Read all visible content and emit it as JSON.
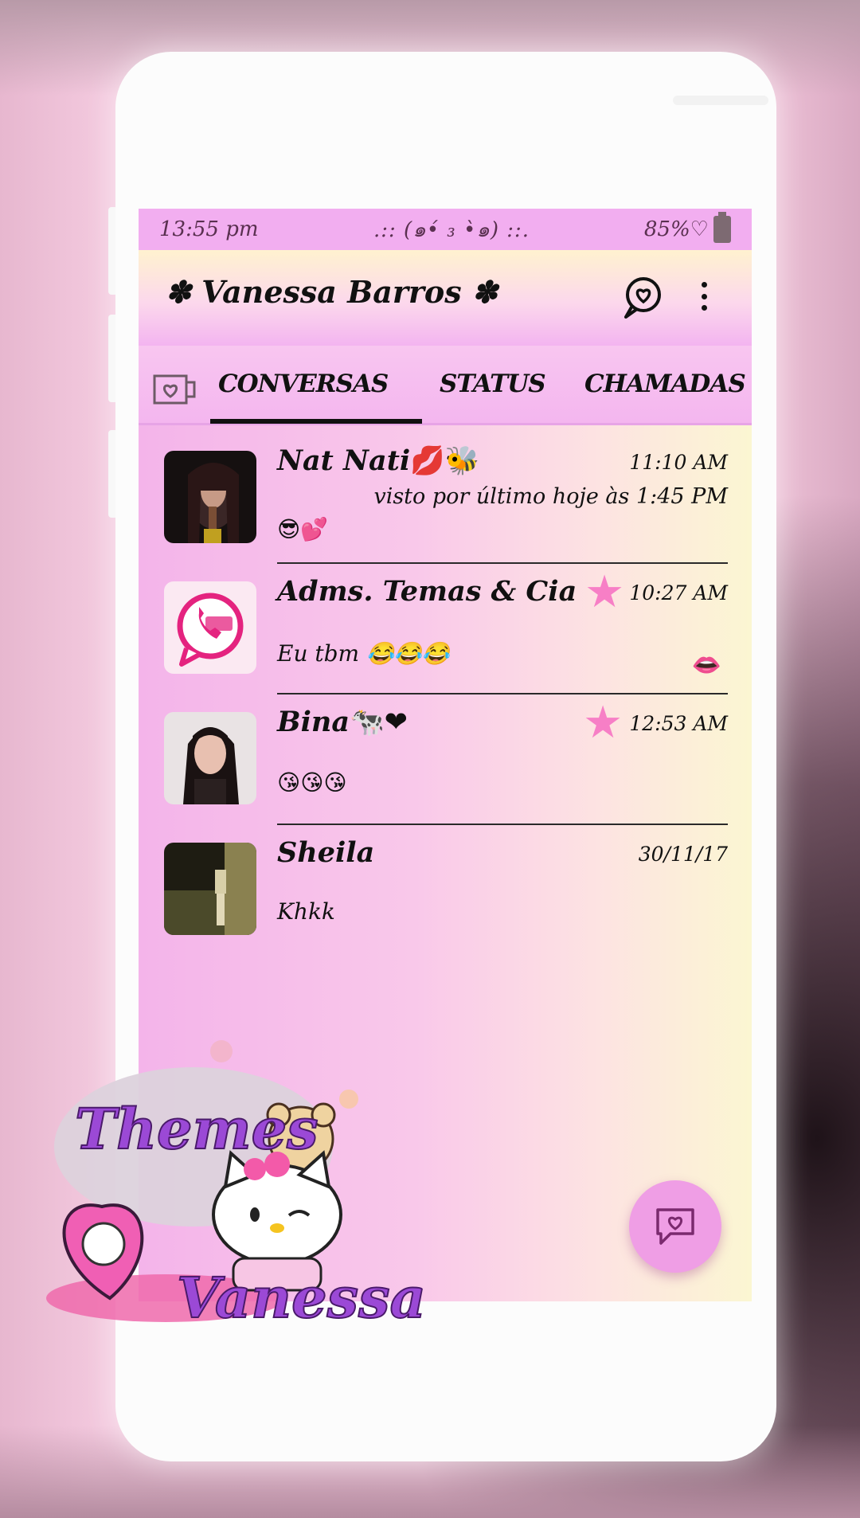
{
  "status_bar": {
    "time": "13:55 pm",
    "center_decoration": ".:: (๑•́ ₃ •̀๑) ::.",
    "battery": "85%♡"
  },
  "app_bar": {
    "title": "✽ Vanessa Barros ✽",
    "search_icon": "chat-heart-icon",
    "menu_icon": "more-vert-icon"
  },
  "tabs": {
    "camera_icon": "camera-heart-icon",
    "items": [
      {
        "label": "CONVERSAS",
        "selected": true
      },
      {
        "label": "STATUS",
        "selected": false
      },
      {
        "label": "CHAMADAS",
        "selected": false
      }
    ]
  },
  "chats": [
    {
      "name": "Nat Nati",
      "name_suffix": "💋🐝",
      "time": "11:10 AM",
      "subtitle": "visto por último hoje às 1:45 PM",
      "message": "😎💕",
      "pinned_star": false
    },
    {
      "name": "Adms. Temas & Cia",
      "name_suffix": "",
      "time": "10:27 AM",
      "subtitle": "",
      "message": "Eu tbm 😂😂😂",
      "trailing": "👄",
      "pinned_star": true
    },
    {
      "name": "Bina",
      "name_suffix": "🐄❤",
      "time": "12:53 AM",
      "subtitle": "",
      "message": "😘😘😘",
      "pinned_star": true
    },
    {
      "name": "Sheila",
      "name_suffix": "",
      "time": "30/11/17",
      "subtitle": "",
      "message": "Khkk",
      "pinned_star": false
    }
  ],
  "fab_icon": "new-chat-heart-icon",
  "watermark": {
    "line1": "Themes",
    "line2": "Vanessa"
  },
  "colors": {
    "status_bar": "#f2aef0",
    "star": "#f77fc6",
    "fab": "#ef9ee5",
    "watermark_text": "#9b49d6"
  }
}
